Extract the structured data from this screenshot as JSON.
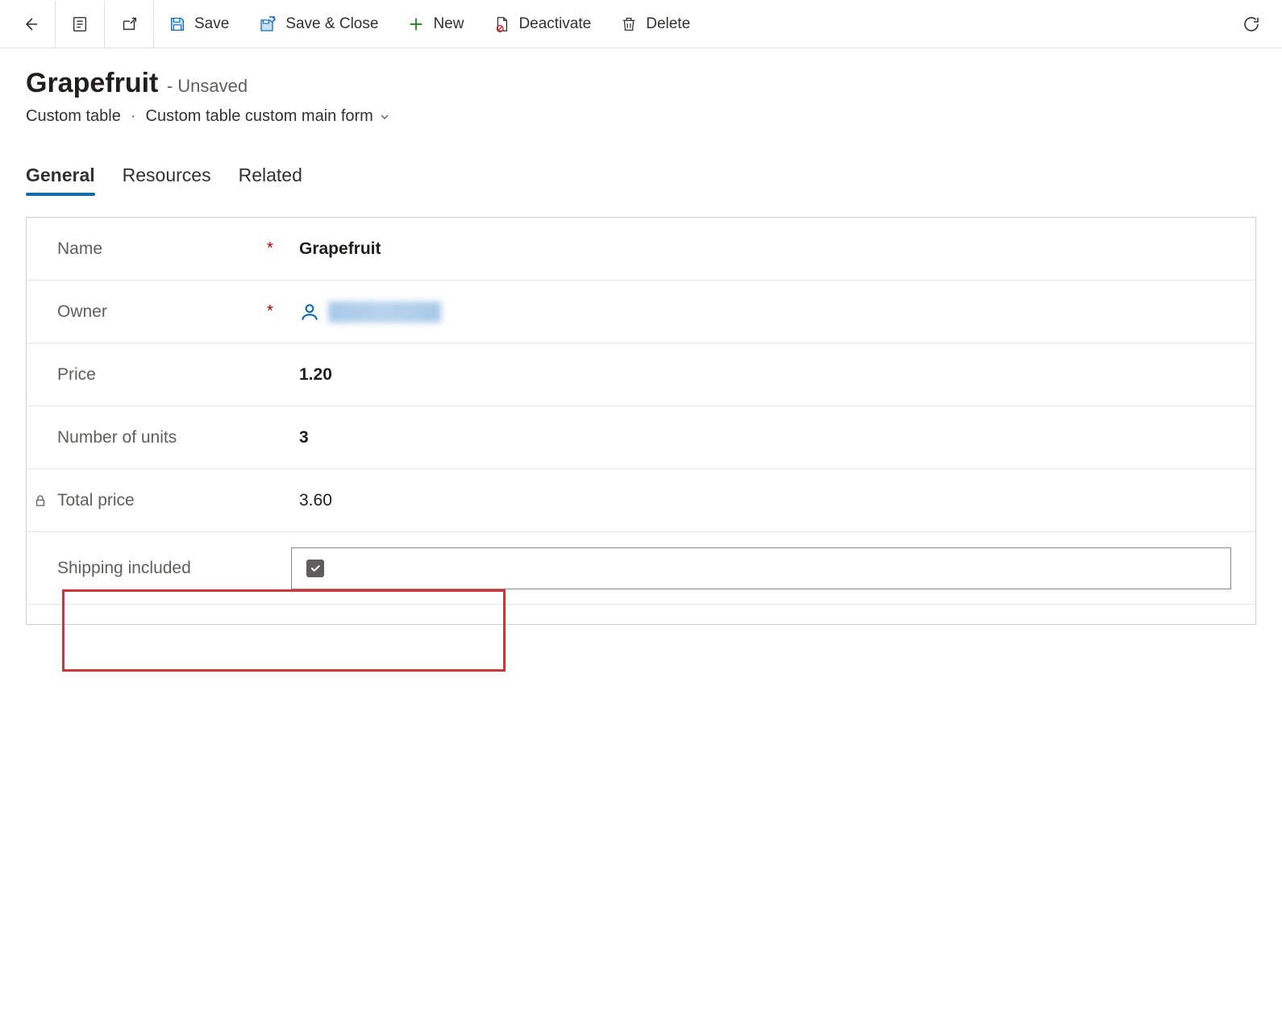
{
  "toolbar": {
    "save": "Save",
    "save_close": "Save & Close",
    "new": "New",
    "deactivate": "Deactivate",
    "delete": "Delete"
  },
  "record": {
    "title": "Grapefruit",
    "status": "- Unsaved",
    "table_name": "Custom table",
    "form_name": "Custom table custom main form"
  },
  "tabs": {
    "general": "General",
    "resources": "Resources",
    "related": "Related"
  },
  "fields": {
    "name": {
      "label": "Name",
      "value": "Grapefruit",
      "required": "*"
    },
    "owner": {
      "label": "Owner",
      "required": "*"
    },
    "price": {
      "label": "Price",
      "value": "1.20"
    },
    "units": {
      "label": "Number of units",
      "value": "3"
    },
    "total": {
      "label": "Total price",
      "value": "3.60"
    },
    "shipping": {
      "label": "Shipping included"
    }
  }
}
